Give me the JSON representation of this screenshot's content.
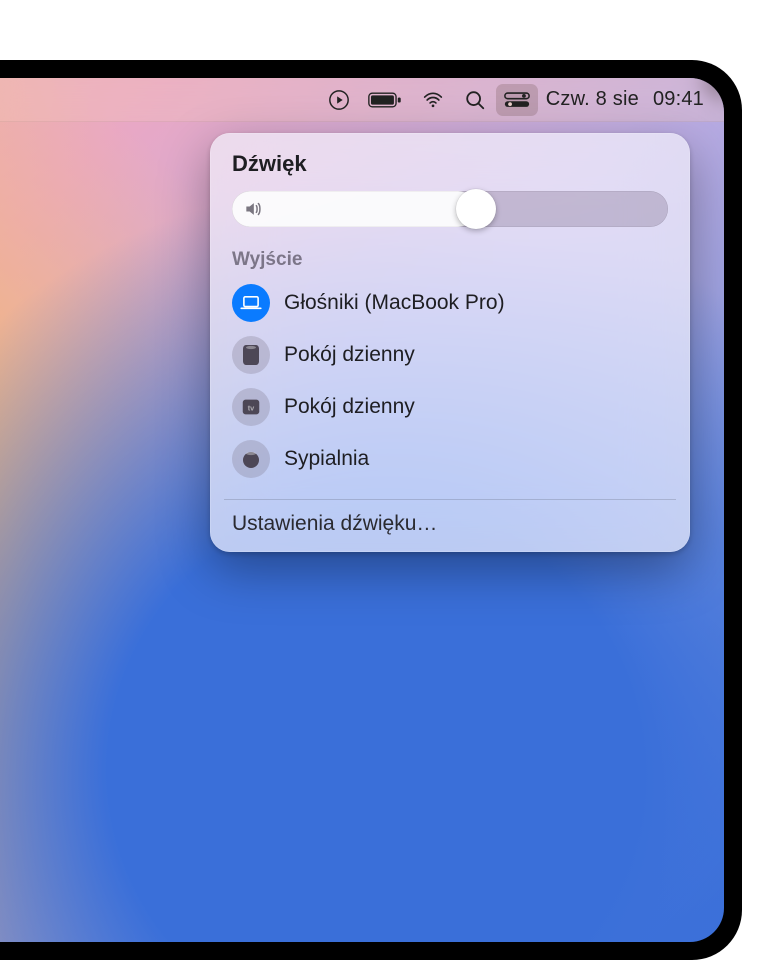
{
  "menubar": {
    "date": "Czw. 8 sie",
    "time": "09:41"
  },
  "panel": {
    "title": "Dźwięk",
    "volume_percent": 56,
    "output_label": "Wyjście",
    "outputs": [
      {
        "icon": "laptop",
        "label": "Głośniki (MacBook Pro)",
        "selected": true
      },
      {
        "icon": "homepod",
        "label": "Pokój dzienny",
        "selected": false
      },
      {
        "icon": "appletv",
        "label": "Pokój dzienny",
        "selected": false
      },
      {
        "icon": "homepod-mini",
        "label": "Sypialnia",
        "selected": false
      }
    ],
    "settings_label": "Ustawienia dźwięku…"
  }
}
